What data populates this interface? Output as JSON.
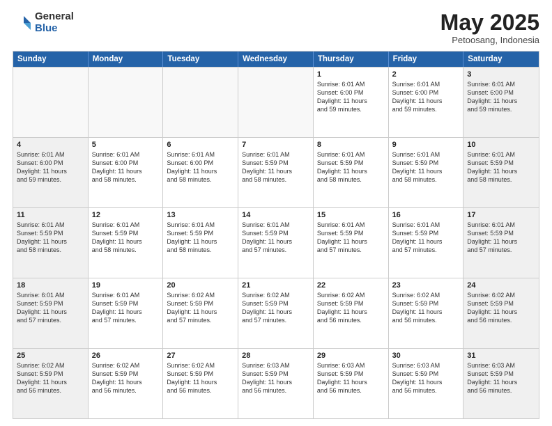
{
  "logo": {
    "general": "General",
    "blue": "Blue"
  },
  "title": {
    "month_year": "May 2025",
    "location": "Petoosang, Indonesia"
  },
  "header_days": [
    "Sunday",
    "Monday",
    "Tuesday",
    "Wednesday",
    "Thursday",
    "Friday",
    "Saturday"
  ],
  "weeks": [
    [
      {
        "date": "",
        "info": ""
      },
      {
        "date": "",
        "info": ""
      },
      {
        "date": "",
        "info": ""
      },
      {
        "date": "",
        "info": ""
      },
      {
        "date": "1",
        "info": "Sunrise: 6:01 AM\nSunset: 6:00 PM\nDaylight: 11 hours\nand 59 minutes."
      },
      {
        "date": "2",
        "info": "Sunrise: 6:01 AM\nSunset: 6:00 PM\nDaylight: 11 hours\nand 59 minutes."
      },
      {
        "date": "3",
        "info": "Sunrise: 6:01 AM\nSunset: 6:00 PM\nDaylight: 11 hours\nand 59 minutes."
      }
    ],
    [
      {
        "date": "4",
        "info": "Sunrise: 6:01 AM\nSunset: 6:00 PM\nDaylight: 11 hours\nand 59 minutes."
      },
      {
        "date": "5",
        "info": "Sunrise: 6:01 AM\nSunset: 6:00 PM\nDaylight: 11 hours\nand 58 minutes."
      },
      {
        "date": "6",
        "info": "Sunrise: 6:01 AM\nSunset: 6:00 PM\nDaylight: 11 hours\nand 58 minutes."
      },
      {
        "date": "7",
        "info": "Sunrise: 6:01 AM\nSunset: 5:59 PM\nDaylight: 11 hours\nand 58 minutes."
      },
      {
        "date": "8",
        "info": "Sunrise: 6:01 AM\nSunset: 5:59 PM\nDaylight: 11 hours\nand 58 minutes."
      },
      {
        "date": "9",
        "info": "Sunrise: 6:01 AM\nSunset: 5:59 PM\nDaylight: 11 hours\nand 58 minutes."
      },
      {
        "date": "10",
        "info": "Sunrise: 6:01 AM\nSunset: 5:59 PM\nDaylight: 11 hours\nand 58 minutes."
      }
    ],
    [
      {
        "date": "11",
        "info": "Sunrise: 6:01 AM\nSunset: 5:59 PM\nDaylight: 11 hours\nand 58 minutes."
      },
      {
        "date": "12",
        "info": "Sunrise: 6:01 AM\nSunset: 5:59 PM\nDaylight: 11 hours\nand 58 minutes."
      },
      {
        "date": "13",
        "info": "Sunrise: 6:01 AM\nSunset: 5:59 PM\nDaylight: 11 hours\nand 58 minutes."
      },
      {
        "date": "14",
        "info": "Sunrise: 6:01 AM\nSunset: 5:59 PM\nDaylight: 11 hours\nand 57 minutes."
      },
      {
        "date": "15",
        "info": "Sunrise: 6:01 AM\nSunset: 5:59 PM\nDaylight: 11 hours\nand 57 minutes."
      },
      {
        "date": "16",
        "info": "Sunrise: 6:01 AM\nSunset: 5:59 PM\nDaylight: 11 hours\nand 57 minutes."
      },
      {
        "date": "17",
        "info": "Sunrise: 6:01 AM\nSunset: 5:59 PM\nDaylight: 11 hours\nand 57 minutes."
      }
    ],
    [
      {
        "date": "18",
        "info": "Sunrise: 6:01 AM\nSunset: 5:59 PM\nDaylight: 11 hours\nand 57 minutes."
      },
      {
        "date": "19",
        "info": "Sunrise: 6:01 AM\nSunset: 5:59 PM\nDaylight: 11 hours\nand 57 minutes."
      },
      {
        "date": "20",
        "info": "Sunrise: 6:02 AM\nSunset: 5:59 PM\nDaylight: 11 hours\nand 57 minutes."
      },
      {
        "date": "21",
        "info": "Sunrise: 6:02 AM\nSunset: 5:59 PM\nDaylight: 11 hours\nand 57 minutes."
      },
      {
        "date": "22",
        "info": "Sunrise: 6:02 AM\nSunset: 5:59 PM\nDaylight: 11 hours\nand 56 minutes."
      },
      {
        "date": "23",
        "info": "Sunrise: 6:02 AM\nSunset: 5:59 PM\nDaylight: 11 hours\nand 56 minutes."
      },
      {
        "date": "24",
        "info": "Sunrise: 6:02 AM\nSunset: 5:59 PM\nDaylight: 11 hours\nand 56 minutes."
      }
    ],
    [
      {
        "date": "25",
        "info": "Sunrise: 6:02 AM\nSunset: 5:59 PM\nDaylight: 11 hours\nand 56 minutes."
      },
      {
        "date": "26",
        "info": "Sunrise: 6:02 AM\nSunset: 5:59 PM\nDaylight: 11 hours\nand 56 minutes."
      },
      {
        "date": "27",
        "info": "Sunrise: 6:02 AM\nSunset: 5:59 PM\nDaylight: 11 hours\nand 56 minutes."
      },
      {
        "date": "28",
        "info": "Sunrise: 6:03 AM\nSunset: 5:59 PM\nDaylight: 11 hours\nand 56 minutes."
      },
      {
        "date": "29",
        "info": "Sunrise: 6:03 AM\nSunset: 5:59 PM\nDaylight: 11 hours\nand 56 minutes."
      },
      {
        "date": "30",
        "info": "Sunrise: 6:03 AM\nSunset: 5:59 PM\nDaylight: 11 hours\nand 56 minutes."
      },
      {
        "date": "31",
        "info": "Sunrise: 6:03 AM\nSunset: 5:59 PM\nDaylight: 11 hours\nand 56 minutes."
      }
    ]
  ]
}
